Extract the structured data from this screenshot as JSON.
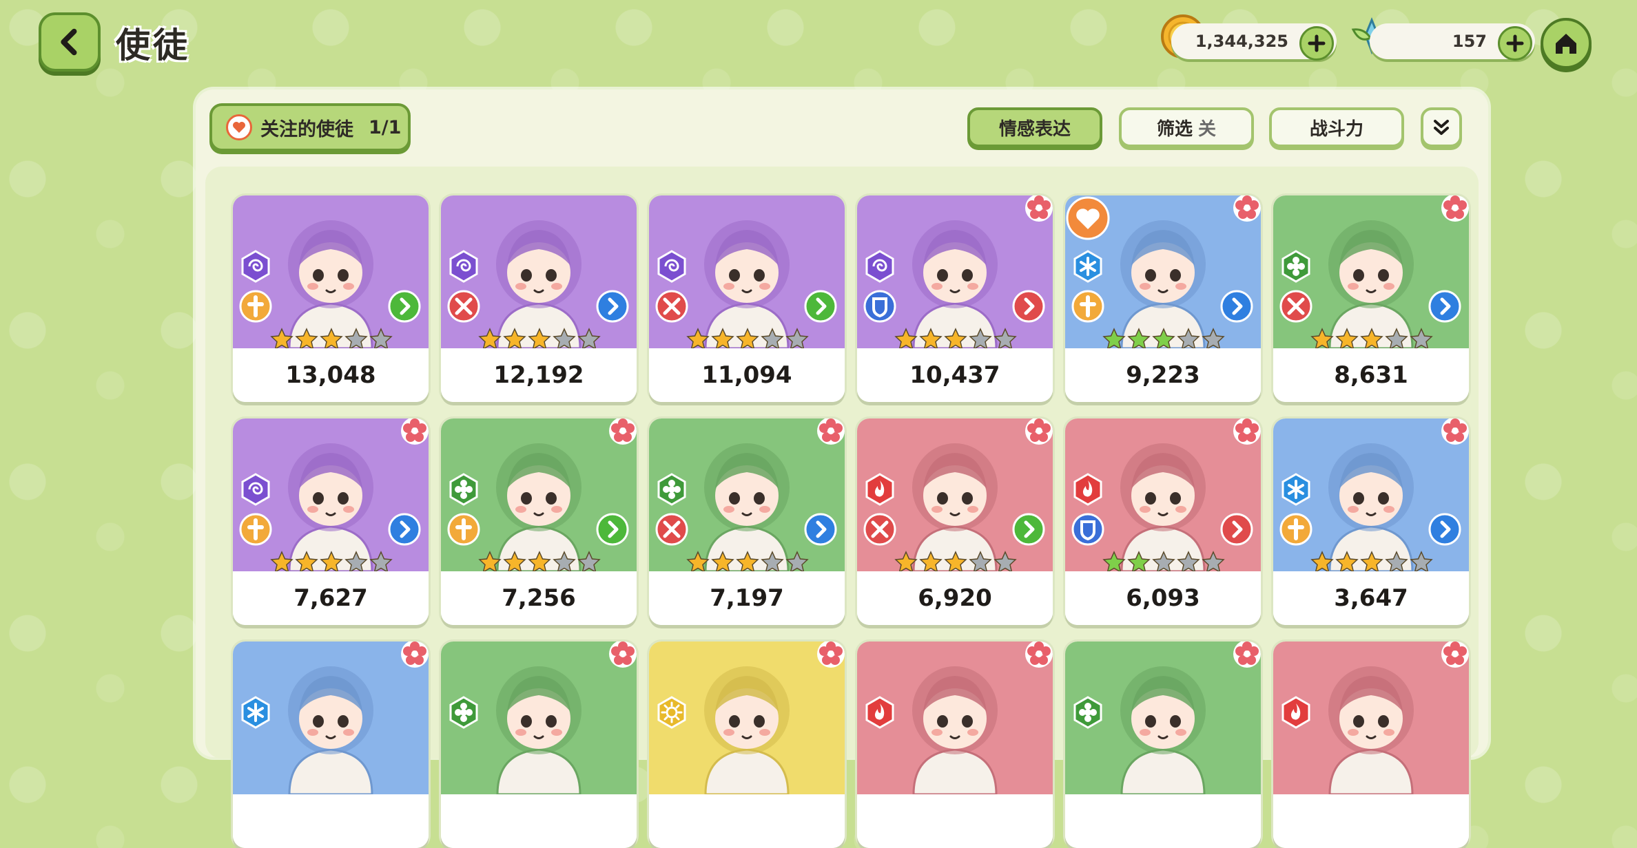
{
  "header": {
    "title": "使徒"
  },
  "currencies": {
    "coins": "1,344,325",
    "gems": "157"
  },
  "toolbar": {
    "favorite_label": "关注的使徒",
    "favorite_count": "1/1",
    "emotion_label": "情感表达",
    "filter_label": "筛选",
    "filter_state": "关",
    "sort_label": "战斗力"
  },
  "colors": {
    "background": "#c7df92",
    "accent_green": "#a9d266",
    "card_purple": "#b88ce0",
    "card_blue": "#8ab4ea",
    "card_green": "#86c57c",
    "card_pink": "#e58e97",
    "card_yellow": "#f0dc6c"
  },
  "cards": [
    {
      "power": "13,048",
      "bg": "purple",
      "attr": "vortex-icon",
      "cls": "cross-icon",
      "arrow": "green",
      "stars": 3,
      "star_color": "gold",
      "flower": false,
      "favorite": false
    },
    {
      "power": "12,192",
      "bg": "purple",
      "attr": "vortex-icon",
      "cls": "crossed-tools-icon",
      "arrow": "blue",
      "stars": 3,
      "star_color": "gold",
      "flower": false,
      "favorite": false
    },
    {
      "power": "11,094",
      "bg": "purple",
      "attr": "vortex-icon",
      "cls": "crossed-tools-icon",
      "arrow": "green",
      "stars": 3,
      "star_color": "gold",
      "flower": false,
      "favorite": false
    },
    {
      "power": "10,437",
      "bg": "purple",
      "attr": "vortex-icon",
      "cls": "shield-icon",
      "arrow": "red",
      "stars": 3,
      "star_color": "gold",
      "flower": true,
      "favorite": false
    },
    {
      "power": "9,223",
      "bg": "blue",
      "attr": "snowflake-icon",
      "cls": "cross-icon",
      "arrow": "blue",
      "stars": 3,
      "star_color": "green",
      "flower": true,
      "favorite": true
    },
    {
      "power": "8,631",
      "bg": "green",
      "attr": "leaf-icon",
      "cls": "crossed-tools-icon",
      "arrow": "blue",
      "stars": 3,
      "star_color": "gold",
      "flower": true,
      "favorite": false
    },
    {
      "power": "7,627",
      "bg": "purple",
      "attr": "vortex-icon",
      "cls": "cross-icon",
      "arrow": "blue",
      "stars": 3,
      "star_color": "gold",
      "flower": true,
      "favorite": false
    },
    {
      "power": "7,256",
      "bg": "green",
      "attr": "leaf-icon",
      "cls": "cross-icon",
      "arrow": "green",
      "stars": 3,
      "star_color": "gold",
      "flower": true,
      "favorite": false
    },
    {
      "power": "7,197",
      "bg": "green",
      "attr": "leaf-icon",
      "cls": "crossed-tools-icon",
      "arrow": "blue",
      "stars": 3,
      "star_color": "gold",
      "flower": true,
      "favorite": false
    },
    {
      "power": "6,920",
      "bg": "pink",
      "attr": "flame-icon",
      "cls": "crossed-tools-icon",
      "arrow": "green",
      "stars": 3,
      "star_color": "gold",
      "flower": true,
      "favorite": false
    },
    {
      "power": "6,093",
      "bg": "pink",
      "attr": "flame-icon",
      "cls": "shield-icon",
      "arrow": "red",
      "stars": 2,
      "star_color": "green",
      "flower": true,
      "favorite": false
    },
    {
      "power": "3,647",
      "bg": "blue",
      "attr": "snowflake-icon",
      "cls": "cross-icon",
      "arrow": "blue",
      "stars": 3,
      "star_color": "gold",
      "flower": true,
      "favorite": false
    },
    {
      "power": "",
      "bg": "blue",
      "attr": "snowflake-icon",
      "cls": "",
      "arrow": "",
      "stars": 0,
      "star_color": "gold",
      "flower": true,
      "favorite": false
    },
    {
      "power": "",
      "bg": "green",
      "attr": "leaf-icon",
      "cls": "",
      "arrow": "",
      "stars": 0,
      "star_color": "gold",
      "flower": true,
      "favorite": false
    },
    {
      "power": "",
      "bg": "yellow",
      "attr": "sun-icon",
      "cls": "",
      "arrow": "",
      "stars": 0,
      "star_color": "gold",
      "flower": true,
      "favorite": false
    },
    {
      "power": "",
      "bg": "pink",
      "attr": "flame-icon",
      "cls": "",
      "arrow": "",
      "stars": 0,
      "star_color": "gold",
      "flower": true,
      "favorite": false
    },
    {
      "power": "",
      "bg": "green",
      "attr": "leaf-icon",
      "cls": "",
      "arrow": "",
      "stars": 0,
      "star_color": "gold",
      "flower": true,
      "favorite": false
    },
    {
      "power": "",
      "bg": "pink",
      "attr": "flame-icon",
      "cls": "",
      "arrow": "",
      "stars": 0,
      "star_color": "gold",
      "flower": true,
      "favorite": false
    }
  ]
}
